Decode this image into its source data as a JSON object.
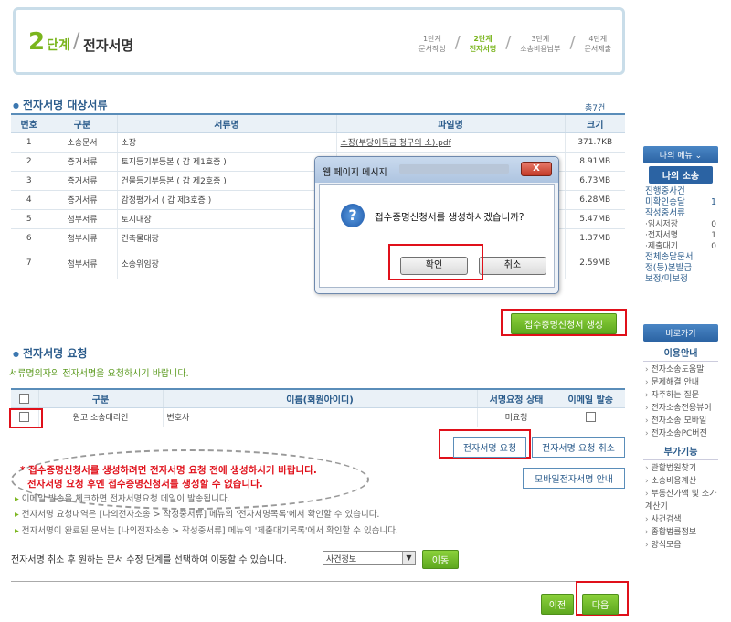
{
  "step": {
    "number": "2",
    "unit": "단계",
    "title": "전자서명",
    "steps": [
      {
        "num": "1단계",
        "name": "문서작성"
      },
      {
        "num": "2단계",
        "name": "전자서명"
      },
      {
        "num": "3단계",
        "name": "소송비용납부"
      },
      {
        "num": "4단계",
        "name": "문서제출"
      }
    ]
  },
  "docs": {
    "heading": "전자서명 대상서류",
    "total": "총7건",
    "columns": [
      "번호",
      "구분",
      "서류명",
      "파일명",
      "크기"
    ],
    "rows": [
      {
        "no": "1",
        "type": "소송문서",
        "name": "소장",
        "file": "소장(부당이득금 청구의 소).pdf",
        "size": "371.7KB"
      },
      {
        "no": "2",
        "type": "증거서류",
        "name": "토지등기부등본 ( 갑 제1호증 )",
        "file": "",
        "size": "8.91MB"
      },
      {
        "no": "3",
        "type": "증거서류",
        "name": "건물등기부등본 ( 갑 제2호증 )",
        "file": "",
        "size": "6.73MB"
      },
      {
        "no": "4",
        "type": "증거서류",
        "name": "감정평가서 ( 갑 제3호증 )",
        "file": "",
        "size": "6.28MB"
      },
      {
        "no": "5",
        "type": "첨부서류",
        "name": "토지대장",
        "file": "",
        "size": "5.47MB"
      },
      {
        "no": "6",
        "type": "첨부서류",
        "name": "건축물대장",
        "file": "",
        "size": "1.37MB"
      },
      {
        "no": "7",
        "type": "첨부서류",
        "name": "소송위임장",
        "file": "",
        "size": "2.59MB"
      }
    ],
    "generate_button": "접수증명신청서 생성"
  },
  "request": {
    "heading": "전자서명 요청",
    "desc": "서류명의자의 전자서명을 요청하시기 바랍니다.",
    "columns": [
      "구분",
      "이름(회원아이디)",
      "서명요청 상태",
      "이메일 발송"
    ],
    "rows": [
      {
        "type": "원고 소송대리인",
        "name": "변호사",
        "status": "미요청"
      }
    ],
    "btn_request": "전자서명 요청",
    "btn_cancel": "전자서명 요청 취소",
    "btn_mobile": "모바일전자서명 안내"
  },
  "warnings": [
    "* 접수증명신청서를 생성하려면 전자서명 요청 전에 생성하시기 바랍니다.",
    "전자서명 요청 후엔 접수증명신청서를 생성할 수 없습니다."
  ],
  "notes": [
    "이메일 발송을 체크하면 전자서명요청 메일이 발송됩니다.",
    "전자서명 요청내역은 [나의전자소송 > 작성중서류] 메뉴의 '전자서명목록'에서 확인할 수 있습니다.",
    "전자서명이 완료된 문서는 [나의전자소송 > 작성중서류] 메뉴의 '제출대기목록'에서 확인할 수 있습니다."
  ],
  "move": {
    "label": "전자서명 취소 후 원하는 문서 수정 단계를 선택하여 이동할 수 있습니다.",
    "selected": "사건정보",
    "button": "이동"
  },
  "nav": {
    "prev": "이전",
    "next": "다음"
  },
  "dialog": {
    "title": "웹 페이지 메시지",
    "message": "접수증명신청서를 생성하시겠습니까?",
    "ok": "확인",
    "cancel": "취소",
    "close": "X"
  },
  "sidebar": {
    "menu": "나의 메뉴 ⌄",
    "my_suit": "나의 소송",
    "items": [
      {
        "label": "진행중사건",
        "count": ""
      },
      {
        "label": "미확인송달",
        "count": "1"
      },
      {
        "label": "작성중서류",
        "count": ""
      }
    ],
    "subitems": [
      {
        "label": "·임시저장",
        "count": "0"
      },
      {
        "label": "·전자서명",
        "count": "1"
      },
      {
        "label": "·제출대기",
        "count": "0"
      }
    ],
    "items2": [
      "전체송달문서",
      "정(등)본발급",
      "보정/미보정"
    ],
    "shortcut": "바로가기",
    "guide_title": "이용안내",
    "guide": [
      "전자소송도움말",
      "문제해결 안내",
      "자주하는 질문",
      "전자소송전용뷰어",
      "전자소송 모바일",
      "전자소송PC버전"
    ],
    "extra_title": "부가기능",
    "extra": [
      "관할법원찾기",
      "소송비용계산",
      "부동산가액 및 소가계산기",
      "사건검색",
      "종합법률정보",
      "양식모음"
    ]
  }
}
